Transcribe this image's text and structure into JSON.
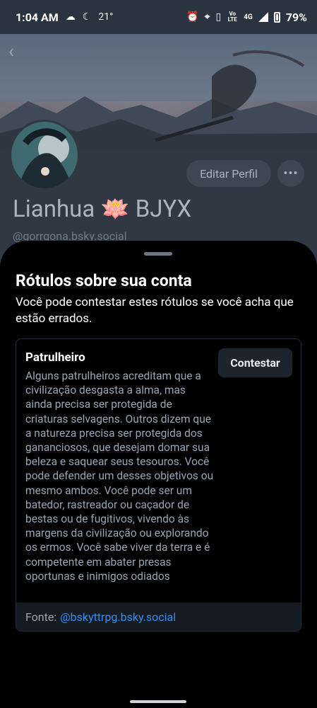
{
  "status_bar": {
    "time": "1:04 AM",
    "temperature": "21°",
    "network": "4G",
    "volte": "Vo LTE",
    "battery": "79%"
  },
  "profile": {
    "display_name": "Lianhua 🪷 BJYX",
    "handle": "@gorrgona.bsky.social",
    "edit_button": "Editar Perfil",
    "more_icon": "•••"
  },
  "sheet": {
    "title": "Rótulos sobre sua conta",
    "description": "Você pode contestar estes rótulos se você acha que estão errados.",
    "label": {
      "name": "Patrulheiro",
      "description": "Alguns patrulheiros acreditam que a civilização desgasta a alma, mas ainda precisa ser protegida de criaturas selvagens. Outros dizem que a natureza precisa ser protegida dos gananciosos, que desejam domar sua beleza e saquear seus tesouros. Você pode defender um desses objetivos ou mesmo ambos. Você pode ser um batedor, rastreador ou caçador de bestas ou de fugitivos, vivendo às margens da civilização ou explorando os ermos. Você sabe viver da terra e é competente em abater presas oportunas e inimigos odiados",
      "contest_button": "Contestar",
      "source_prefix": "Fonte:",
      "source_link": "@bskyttrpg.bsky.social"
    }
  },
  "colors": {
    "accent_link": "#2f8ff0",
    "sheet_bg": "#000000",
    "dimmed_profile_bg": "#2f3843"
  }
}
